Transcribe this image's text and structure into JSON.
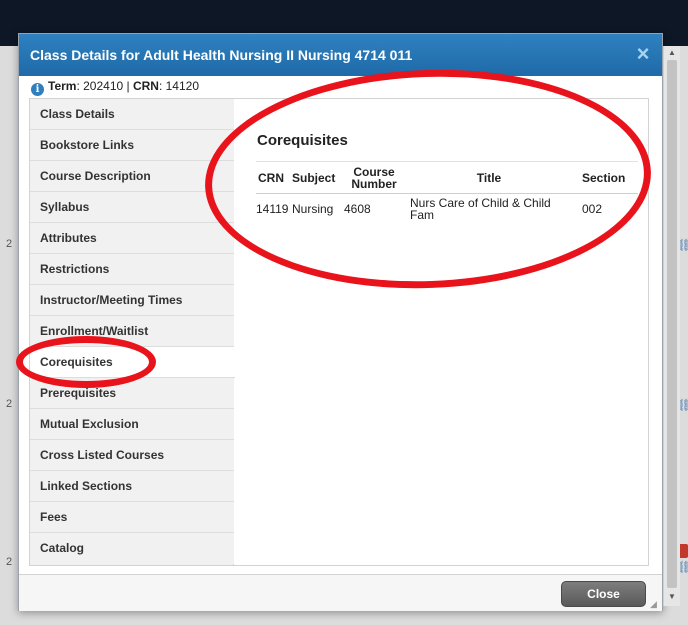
{
  "dialog": {
    "title": "Class Details for Adult Health Nursing II Nursing 4714 011",
    "close_icon": "×"
  },
  "term_row": {
    "term_label": "Term",
    "term_value": ": 202410 | ",
    "crn_label": "CRN",
    "crn_value": ": 14120"
  },
  "nav": {
    "items": [
      {
        "label": "Class Details"
      },
      {
        "label": "Bookstore Links"
      },
      {
        "label": "Course Description"
      },
      {
        "label": "Syllabus"
      },
      {
        "label": "Attributes"
      },
      {
        "label": "Restrictions"
      },
      {
        "label": "Instructor/Meeting Times"
      },
      {
        "label": "Enrollment/Waitlist"
      },
      {
        "label": "Corequisites"
      },
      {
        "label": "Prerequisites"
      },
      {
        "label": "Mutual Exclusion"
      },
      {
        "label": "Cross Listed Courses"
      },
      {
        "label": "Linked Sections"
      },
      {
        "label": "Fees"
      },
      {
        "label": "Catalog"
      }
    ],
    "active": "Corequisites"
  },
  "content": {
    "title": "Corequisites",
    "table": {
      "headers": {
        "crn": "CRN",
        "subject": "Subject",
        "course_number_line1": "Course",
        "course_number_line2": "Number",
        "title": "Title",
        "section": "Section"
      },
      "rows": [
        {
          "crn": "14119",
          "subject": "Nursing",
          "course_number": "4608",
          "title_line1": "Nurs Care of Child & Child",
          "title_line2": "Fam",
          "section": "002"
        }
      ]
    }
  },
  "footer": {
    "close_label": "Close"
  },
  "background": {
    "fragment": "2"
  },
  "colors": {
    "titlebar": "#1f6aa8",
    "annotation": "#e8131b",
    "nav_bg": "#efefef"
  },
  "icons": [
    "info-icon",
    "close-icon",
    "chain-link-icon",
    "resize-grip-icon"
  ]
}
